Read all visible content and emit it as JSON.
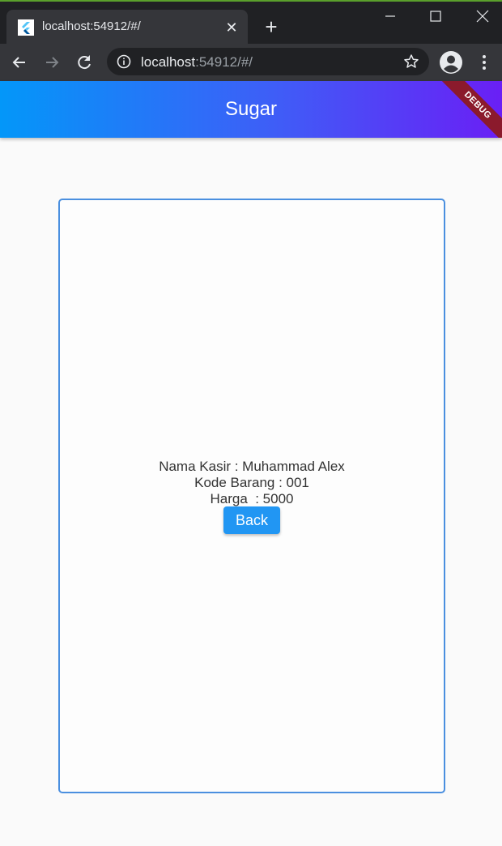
{
  "browser": {
    "tab_title": "localhost:54912/#/",
    "url_host": "localhost",
    "url_rest": ":54912/#/",
    "favicon": "flutter-icon"
  },
  "appbar": {
    "title": "Sugar",
    "debug_label": "DEBUG",
    "gradient": [
      "#0397f9",
      "#6a1ff5"
    ]
  },
  "card": {
    "lines": [
      "Nama Kasir : Muhammad Alex",
      "Kode Barang : 001",
      "Harga  : 5000"
    ],
    "back_label": "Back",
    "border_color": "#4a8fdf",
    "button_color": "#2196f3"
  }
}
